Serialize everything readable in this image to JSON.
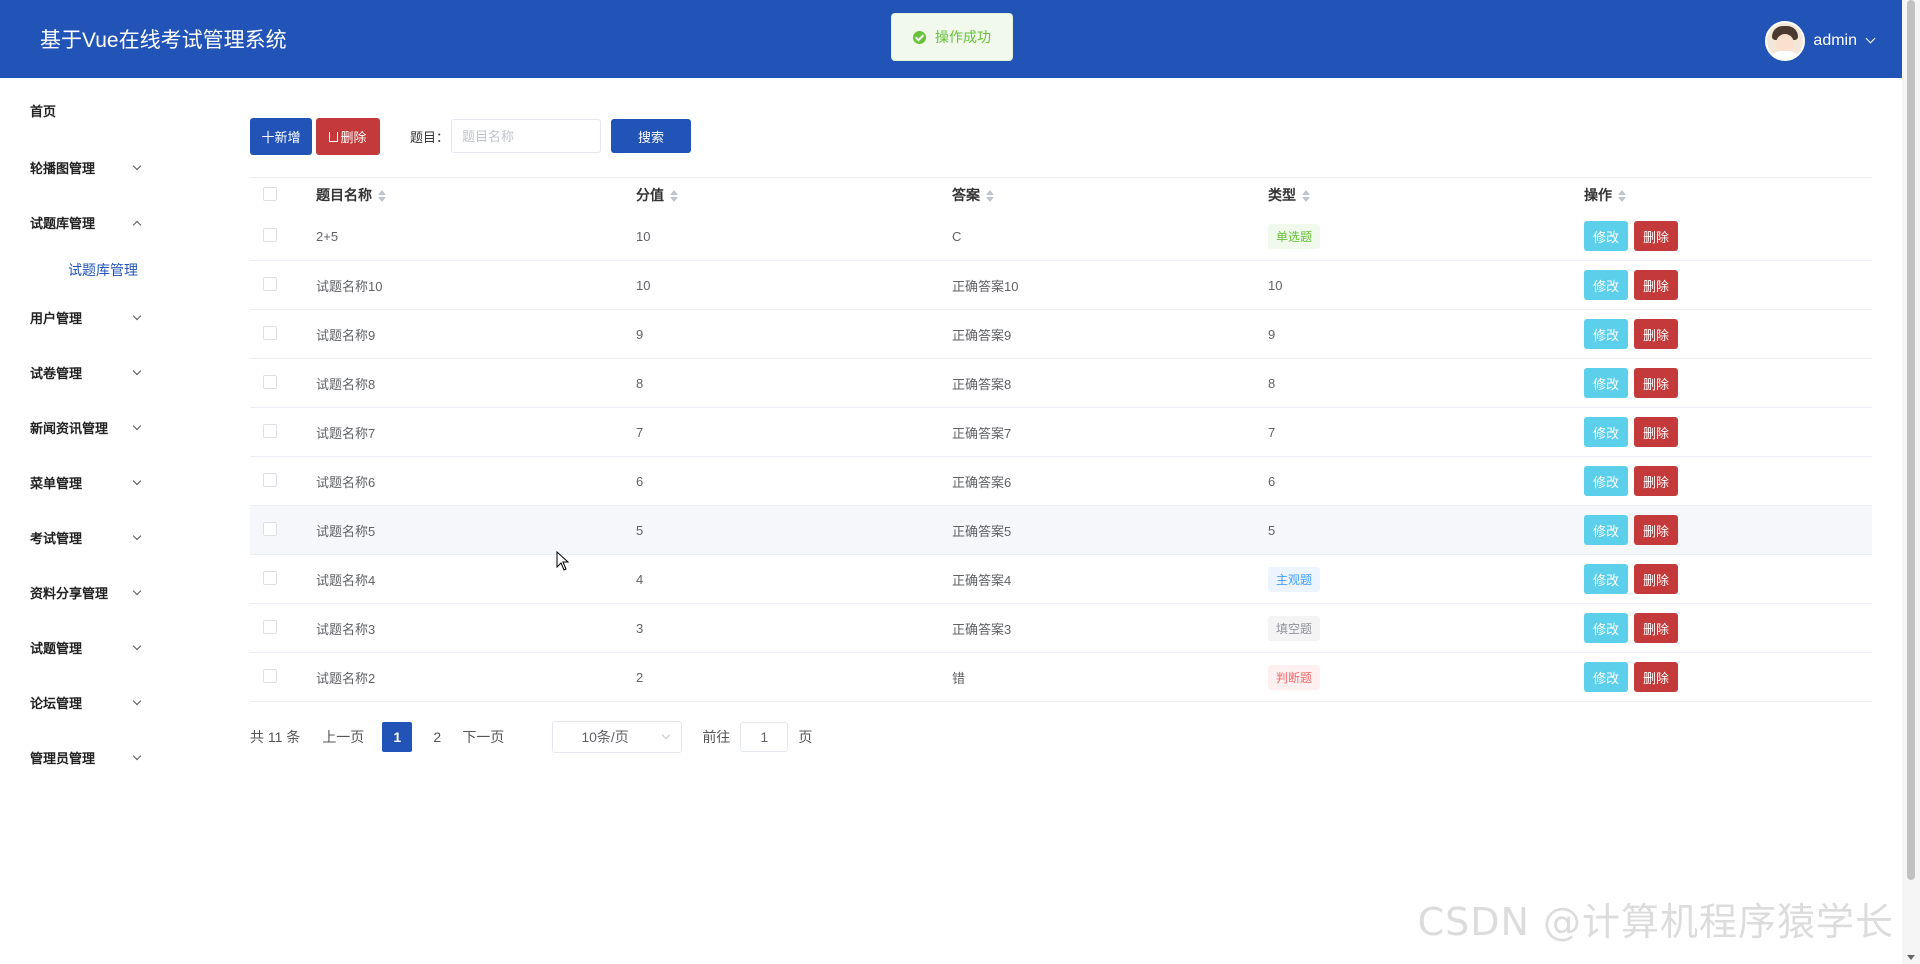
{
  "header": {
    "title": "基于Vue在线考试管理系统",
    "username": "admin",
    "brand_color": "#2254b8"
  },
  "toast": {
    "message": "操作成功"
  },
  "sidebar": {
    "items": [
      {
        "label": "首页",
        "expandable": false
      },
      {
        "label": "轮播图管理",
        "expandable": true
      },
      {
        "label": "试题库管理",
        "expandable": true,
        "expanded": true,
        "children": [
          {
            "label": "试题库管理",
            "active": true
          }
        ]
      },
      {
        "label": "用户管理",
        "expandable": true
      },
      {
        "label": "试卷管理",
        "expandable": true
      },
      {
        "label": "新闻资讯管理",
        "expandable": true
      },
      {
        "label": "菜单管理",
        "expandable": true
      },
      {
        "label": "考试管理",
        "expandable": true
      },
      {
        "label": "资料分享管理",
        "expandable": true
      },
      {
        "label": "试题管理",
        "expandable": true
      },
      {
        "label": "论坛管理",
        "expandable": true
      },
      {
        "label": "管理员管理",
        "expandable": true
      }
    ]
  },
  "toolbar": {
    "add_label": "十新增",
    "delete_label": "删除",
    "search_label": "题目：",
    "search_placeholder": "题目名称",
    "search_button": "搜索"
  },
  "table": {
    "columns": [
      "题目名称",
      "分值",
      "答案",
      "类型",
      "操作"
    ],
    "rows": [
      {
        "name": "2+5",
        "score": "10",
        "answer": "C",
        "type": "单选题",
        "type_style": "green"
      },
      {
        "name": "试题名称10",
        "score": "10",
        "answer": "正确答案10",
        "type": "10",
        "type_style": ""
      },
      {
        "name": "试题名称9",
        "score": "9",
        "answer": "正确答案9",
        "type": "9",
        "type_style": ""
      },
      {
        "name": "试题名称8",
        "score": "8",
        "answer": "正确答案8",
        "type": "8",
        "type_style": ""
      },
      {
        "name": "试题名称7",
        "score": "7",
        "answer": "正确答案7",
        "type": "7",
        "type_style": ""
      },
      {
        "name": "试题名称6",
        "score": "6",
        "answer": "正确答案6",
        "type": "6",
        "type_style": ""
      },
      {
        "name": "试题名称5",
        "score": "5",
        "answer": "正确答案5",
        "type": "5",
        "type_style": "",
        "hover": true
      },
      {
        "name": "试题名称4",
        "score": "4",
        "answer": "正确答案4",
        "type": "主观题",
        "type_style": "blue"
      },
      {
        "name": "试题名称3",
        "score": "3",
        "answer": "正确答案3",
        "type": "填空题",
        "type_style": "gray"
      },
      {
        "name": "试题名称2",
        "score": "2",
        "answer": "错",
        "type": "判断题",
        "type_style": "red"
      }
    ],
    "edit_label": "修改",
    "delete_label": "删除"
  },
  "pagination": {
    "total_text": "共 11 条",
    "prev": "上一页",
    "pages": [
      "1",
      "2"
    ],
    "current": "1",
    "next": "下一页",
    "page_size": "10条/页",
    "goto_label": "前往",
    "goto_value": "1",
    "goto_suffix": "页"
  },
  "watermark": "CSDN @计算机程序猿学长"
}
